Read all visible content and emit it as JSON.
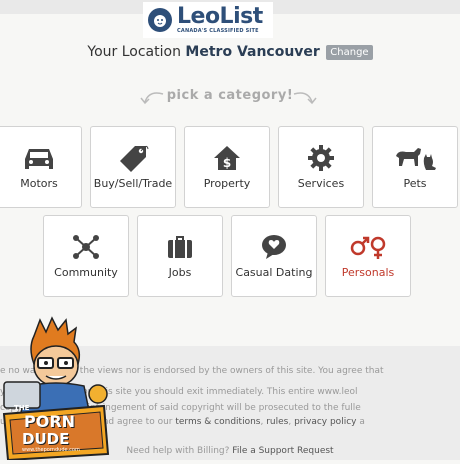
{
  "header": {
    "logo_name": "LeoList",
    "logo_tagline": "CANADA'S CLASSIFIED SITE"
  },
  "location": {
    "prefix": "Your Location",
    "city": "Metro Vancouver",
    "change_label": "Change"
  },
  "pick_label": "pick a category!",
  "categories": [
    {
      "label": "Motors",
      "icon": "car-icon"
    },
    {
      "label": "Buy/Sell/Trade",
      "icon": "tag-icon"
    },
    {
      "label": "Property",
      "icon": "house-dollar-icon"
    },
    {
      "label": "Services",
      "icon": "gear-icon"
    },
    {
      "label": "Pets",
      "icon": "dog-cat-icon"
    },
    {
      "label": "Community",
      "icon": "network-icon"
    },
    {
      "label": "Jobs",
      "icon": "briefcase-icon"
    },
    {
      "label": "Casual Dating",
      "icon": "chat-heart-icon"
    },
    {
      "label": "Personals",
      "icon": "gender-symbols-icon"
    }
  ],
  "colors": {
    "brand": "#2e4f79",
    "personals": "#c0392b"
  },
  "footer": {
    "line1": "e no way reflects the views nor is endorsed by the owners of this site. You agree that",
    "line2": "y material posted on this site you should exit immediately. This entire www.leol",
    "line3": "copyright, and any infringement of said copyright will be prosecuted to the fulle",
    "line4_prefix": "u agree to the above and agree to our",
    "terms_link": "terms & conditions",
    "rules_link": "rules",
    "privacy_link": "privacy policy",
    "line4_suffix": "a",
    "help_prefix": "Need help with Billing?",
    "help_link": "File a Support Request"
  },
  "badge": {
    "line1": "THE",
    "line2": "PORN",
    "line3": "DUDE",
    "url": "www.theporndude.com"
  }
}
